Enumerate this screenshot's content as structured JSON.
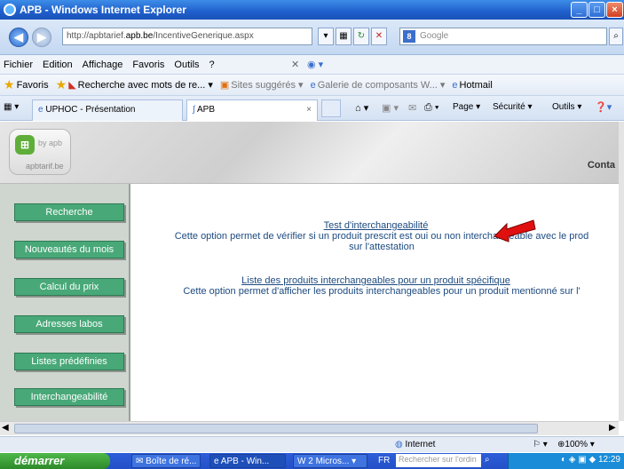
{
  "window": {
    "title": "APB - Windows Internet Explorer"
  },
  "address": {
    "url_prefix": "http://apbtarief.",
    "url_domain": "apb.be",
    "url_suffix": "/IncentiveGenerique.aspx",
    "search_placeholder": "Google"
  },
  "menu": [
    "Fichier",
    "Edition",
    "Affichage",
    "Favoris",
    "Outils",
    "?"
  ],
  "favorites": {
    "label": "Favoris",
    "items": [
      "Recherche avec mots de re...",
      "Sites suggérés",
      "Galerie de composants W...",
      "Hotmail"
    ]
  },
  "tabs": [
    {
      "label": "UPHOC - Présentation"
    },
    {
      "label": "APB"
    }
  ],
  "command_bar": {
    "page": "Page",
    "security": "Sécurité",
    "tools": "Outils"
  },
  "site": {
    "logo_by": "by apb",
    "logo_name": "apbtarif.be",
    "contact": "Conta"
  },
  "sidebar": {
    "buttons": [
      "Recherche",
      "Nouveautés du mois",
      "Calcul du prix",
      "Adresses labos",
      "Listes prédéfinies",
      "Interchangeabilité"
    ]
  },
  "main": {
    "link1": "Test d'interchangeabilité",
    "desc1_line1": "Cette option permet de vérifier si un produit prescrit est oui ou non interchangeable avec le prod",
    "desc1_line2": "sur l'attestation",
    "link2": "Liste des produits interchangeables pour un produit spécifique",
    "desc2": "Cette option permet d'afficher les produits interchangeables pour un produit mentionné sur l'"
  },
  "status": {
    "zone": "Internet",
    "zoom": "100%"
  },
  "taskbar": {
    "start": "démarrer",
    "tasks": [
      "Boîte de ré...",
      "APB - Win...",
      "2 Micros..."
    ],
    "lang": "FR",
    "search_placeholder": "Rechercher sur l'ordin",
    "time": "12:29"
  },
  "colors": {
    "sidebar_button": "#48a878",
    "link": "#1c4a80",
    "arrow": "#e01010"
  }
}
